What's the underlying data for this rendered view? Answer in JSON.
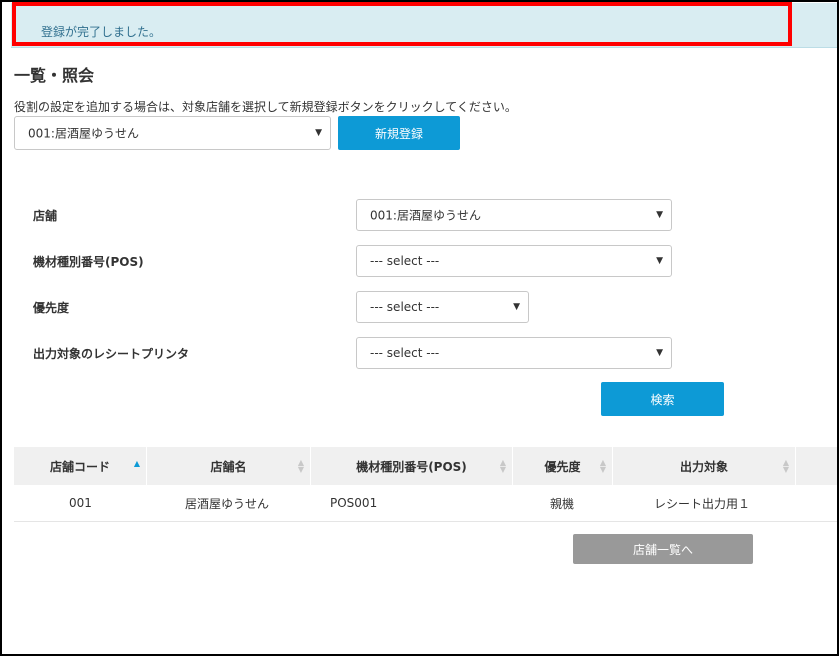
{
  "alert": {
    "message": "登録が完了しました。"
  },
  "page": {
    "title": "一覧・照会",
    "help_text": "役割の設定を追加する場合は、対象店舗を選択して新規登録ボタンをクリックしてください。"
  },
  "top_store_select": {
    "value": "001:居酒屋ゆうせん"
  },
  "new_button": {
    "label": "新規登録"
  },
  "search_form": {
    "store": {
      "label": "店舗",
      "value": "001:居酒屋ゆうせん"
    },
    "device_type": {
      "label": "機材種別番号(POS)",
      "value": "--- select ---"
    },
    "priority": {
      "label": "優先度",
      "value": "--- select ---"
    },
    "receipt_printer": {
      "label": "出力対象のレシートプリンタ",
      "value": "--- select ---"
    },
    "search_button": "検索"
  },
  "table": {
    "headers": [
      "店舗コード",
      "店舗名",
      "機材種別番号(POS)",
      "優先度",
      "出力対象"
    ],
    "rows": [
      [
        "001",
        "居酒屋ゆうせん",
        "POS001",
        "親機",
        "レシート出力用１"
      ]
    ]
  },
  "back_button": {
    "label": "店舗一覧へ"
  },
  "icons": {
    "caret": "caret-down-icon",
    "sort": "sort-icon",
    "sort_asc": "sort-asc-icon"
  },
  "colors": {
    "primary": "#0d9ad6",
    "alert_bg": "#d9edf2",
    "highlight": "#ff0000",
    "gray_button": "#999999"
  }
}
